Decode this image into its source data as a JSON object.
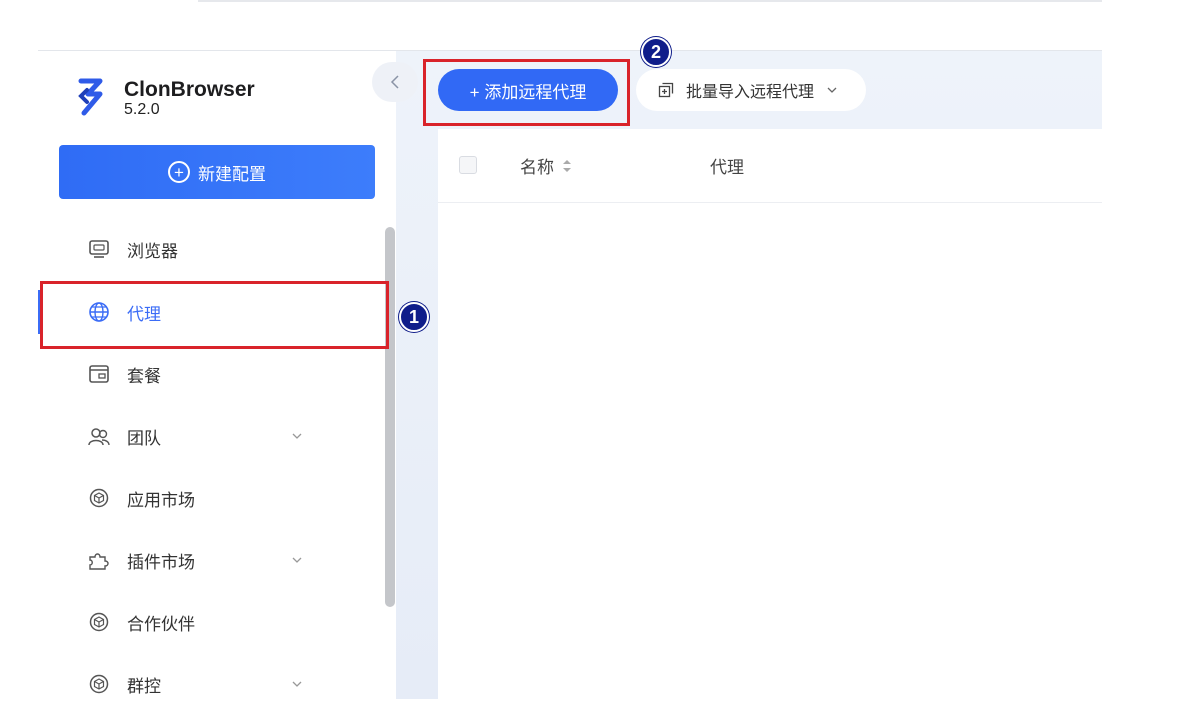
{
  "app": {
    "name": "ClonBrowser",
    "version": "5.2.0"
  },
  "sidebar": {
    "new_config_label": "新建配置",
    "items": [
      {
        "label": "浏览器",
        "icon": "browser-icon",
        "active": false,
        "has_submenu": false
      },
      {
        "label": "代理",
        "icon": "globe-icon",
        "active": true,
        "has_submenu": false
      },
      {
        "label": "套餐",
        "icon": "wallet-icon",
        "active": false,
        "has_submenu": false
      },
      {
        "label": "团队",
        "icon": "team-icon",
        "active": false,
        "has_submenu": true
      },
      {
        "label": "应用市场",
        "icon": "cube-icon",
        "active": false,
        "has_submenu": false
      },
      {
        "label": "插件市场",
        "icon": "puzzle-icon",
        "active": false,
        "has_submenu": true
      },
      {
        "label": "合作伙伴",
        "icon": "cube-icon",
        "active": false,
        "has_submenu": false
      },
      {
        "label": "群控",
        "icon": "cube-icon",
        "active": false,
        "has_submenu": true
      }
    ]
  },
  "toolbar": {
    "add_remote_label": "+ 添加远程代理",
    "bulk_import_label": "批量导入远程代理"
  },
  "table": {
    "columns": [
      "名称",
      "代理"
    ],
    "rows": []
  },
  "annotations": {
    "step1": "1",
    "step2": "2"
  },
  "colors": {
    "accent": "#3169f5",
    "highlight": "#d9232a",
    "badge": "#0f1d8a"
  }
}
